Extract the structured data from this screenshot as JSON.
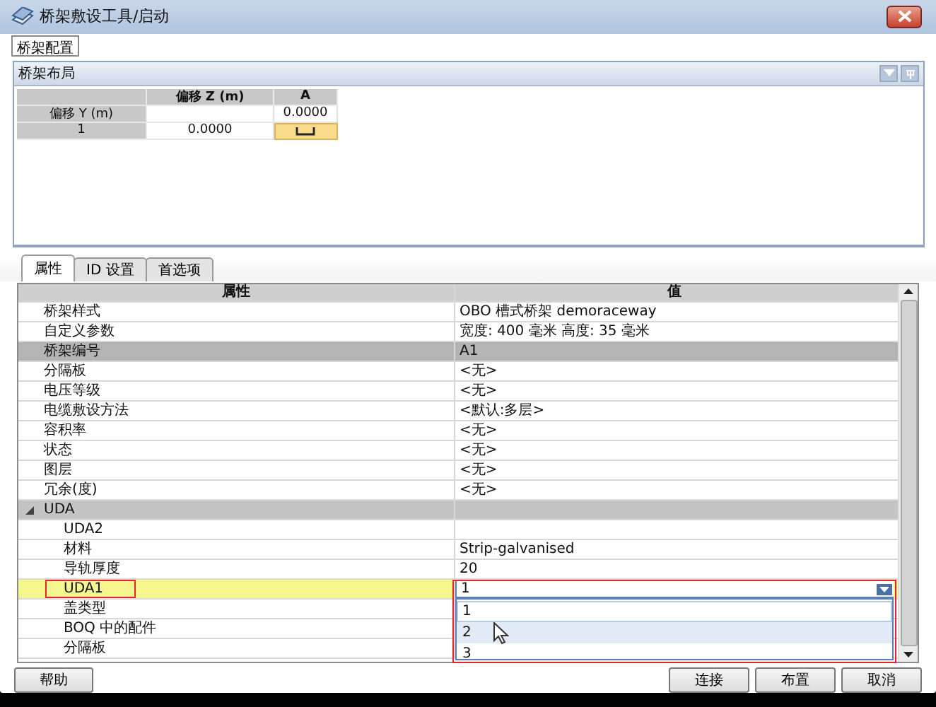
{
  "window": {
    "title": "桥架敷设工具/启动"
  },
  "toolbar": {
    "button": "桥架配置"
  },
  "layout_panel": {
    "title": "桥架布局",
    "grid": {
      "columns": [
        "偏移 Z (m)",
        "A"
      ],
      "rows": [
        {
          "header": "偏移 Y (m)",
          "cells": [
            "",
            "0.0000"
          ]
        },
        {
          "header": "1",
          "cells": [
            "0.0000",
            ""
          ]
        }
      ]
    }
  },
  "tabs": [
    {
      "label": "属性",
      "selected": true
    },
    {
      "label": "ID 设置",
      "selected": false
    },
    {
      "label": "首选项",
      "selected": false
    }
  ],
  "properties": {
    "columns": [
      "属性",
      "值"
    ],
    "rows": [
      {
        "name": "桥架样式",
        "value": "OBO 槽式桥架 demoraceway",
        "selected": false,
        "editing": false
      },
      {
        "name": "自定义参数",
        "value": "宽度: 400 毫米  高度: 35 毫米",
        "selected": false,
        "editing": false
      },
      {
        "name": "桥架编号",
        "value": "A1",
        "selected": true,
        "editing": false
      },
      {
        "name": "分隔板",
        "value": "<无>",
        "selected": false,
        "editing": false
      },
      {
        "name": "电压等级",
        "value": "<无>",
        "selected": false,
        "editing": false
      },
      {
        "name": "电缆敷设方法",
        "value": "<默认:多层>",
        "selected": false,
        "editing": false
      },
      {
        "name": "容积率",
        "value": "<无>",
        "selected": false,
        "editing": false
      },
      {
        "name": "状态",
        "value": "<无>",
        "selected": false,
        "editing": false
      },
      {
        "name": "图层",
        "value": "<无>",
        "selected": false,
        "editing": false
      },
      {
        "name": "冗余(度)",
        "value": "<无>",
        "selected": false,
        "editing": false
      }
    ],
    "groups": [
      {
        "name": "UDA",
        "expanded": true,
        "rows": [
          {
            "name": "UDA2",
            "value": "",
            "selected": false,
            "editing": false
          },
          {
            "name": "材料",
            "value": "Strip-galvanised",
            "selected": false,
            "editing": false
          },
          {
            "name": "导轨厚度",
            "value": "20",
            "selected": false,
            "editing": false
          },
          {
            "name": "UDA1",
            "value": "1",
            "selected": false,
            "editing": true
          },
          {
            "name": "盖类型",
            "value": "",
            "selected": false,
            "editing": false
          },
          {
            "name": "BOQ 中的配件",
            "value": "",
            "selected": false,
            "editing": false
          },
          {
            "name": "分隔板",
            "value": "",
            "selected": false,
            "editing": false
          }
        ]
      }
    ],
    "dropdown": {
      "options": [
        {
          "label": "1",
          "selected": false
        },
        {
          "label": "2",
          "selected": true
        },
        {
          "label": "3",
          "selected": false
        }
      ]
    }
  },
  "buttons": {
    "left": [
      "帮助"
    ],
    "right": [
      "连接",
      "布置",
      "取消"
    ]
  }
}
